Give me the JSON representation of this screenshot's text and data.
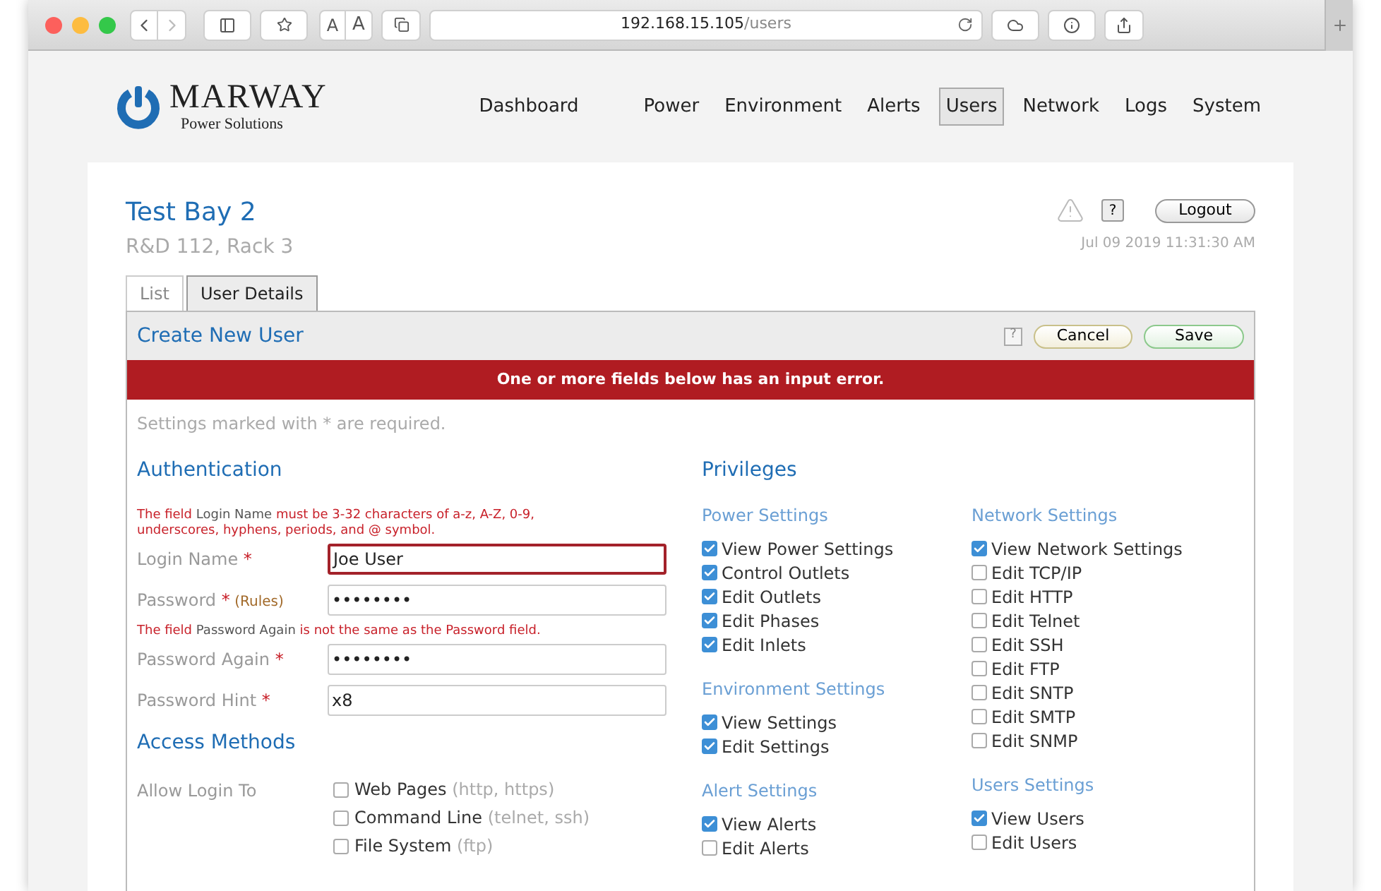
{
  "browser": {
    "font_buttons": [
      "A",
      "A"
    ],
    "url_host": "192.168.15.105",
    "url_path": "/users"
  },
  "nav": {
    "logo": {
      "name": "MARWAY",
      "tagline": "Power Solutions"
    },
    "items": [
      {
        "label": "Dashboard",
        "selected": false
      },
      {
        "label": "Power",
        "selected": false
      },
      {
        "label": "Environment",
        "selected": false
      },
      {
        "label": "Alerts",
        "selected": false
      },
      {
        "label": "Users",
        "selected": true
      },
      {
        "label": "Network",
        "selected": false
      },
      {
        "label": "Logs",
        "selected": false
      },
      {
        "label": "System",
        "selected": false
      }
    ]
  },
  "header": {
    "title": "Test Bay 2",
    "subtitle": "R&D 112, Rack 3",
    "help": "?",
    "logout": "Logout",
    "datetime": "Jul 09 2019 11:31:30 AM"
  },
  "tabs": [
    {
      "label": "List",
      "selected": false
    },
    {
      "label": "User Details",
      "selected": true
    }
  ],
  "panel": {
    "title": "Create New User",
    "help": "?",
    "cancel": "Cancel",
    "save": "Save",
    "error_banner": "One or more fields below has an input error.",
    "required_note": "Settings marked with * are required."
  },
  "authentication": {
    "heading": "Authentication",
    "rows": [
      {
        "kind": "error",
        "before": "The field",
        "field": "Login Name",
        "after": "must be 3-32 characters of a-z, A-Z, 0-9, underscores, hyphens, periods, and @ symbol."
      },
      {
        "kind": "field",
        "label": "Login Name",
        "required": "*",
        "value": "Joe User",
        "invalid": true
      },
      {
        "kind": "field",
        "label": "Password",
        "required": "*",
        "note": "(Rules)",
        "value": "••••••••",
        "invalid": false
      },
      {
        "kind": "error",
        "before": "The field",
        "field": "Password Again",
        "after": "is not the same as the Password field."
      },
      {
        "kind": "field",
        "label": "Password Again",
        "required": "*",
        "value": "••••••••",
        "invalid": false
      },
      {
        "kind": "field",
        "label": "Password Hint",
        "required": "*",
        "value": "x8",
        "invalid": false
      }
    ]
  },
  "access": {
    "heading": "Access Methods",
    "label": "Allow Login To",
    "options": [
      {
        "label": "Web Pages",
        "hint": "(http, https)",
        "checked": false
      },
      {
        "label": "Command Line",
        "hint": "(telnet, ssh)",
        "checked": false
      },
      {
        "label": "File System",
        "hint": "(ftp)",
        "checked": false
      }
    ]
  },
  "privileges": {
    "heading": "Privileges",
    "columns": [
      [
        {
          "title": "Power Settings",
          "items": [
            {
              "label": "View Power Settings",
              "checked": true
            },
            {
              "label": "Control Outlets",
              "checked": true
            },
            {
              "label": "Edit Outlets",
              "checked": true
            },
            {
              "label": "Edit Phases",
              "checked": true
            },
            {
              "label": "Edit Inlets",
              "checked": true
            }
          ]
        },
        {
          "title": "Environment Settings",
          "items": [
            {
              "label": "View Settings",
              "checked": true
            },
            {
              "label": "Edit Settings",
              "checked": true
            }
          ]
        },
        {
          "title": "Alert Settings",
          "items": [
            {
              "label": "View Alerts",
              "checked": true
            },
            {
              "label": "Edit Alerts",
              "checked": false
            }
          ]
        }
      ],
      [
        {
          "title": "Network Settings",
          "items": [
            {
              "label": "View Network Settings",
              "checked": true
            },
            {
              "label": "Edit TCP/IP",
              "checked": false
            },
            {
              "label": "Edit HTTP",
              "checked": false
            },
            {
              "label": "Edit Telnet",
              "checked": false
            },
            {
              "label": "Edit SSH",
              "checked": false
            },
            {
              "label": "Edit FTP",
              "checked": false
            },
            {
              "label": "Edit SNTP",
              "checked": false
            },
            {
              "label": "Edit SMTP",
              "checked": false
            },
            {
              "label": "Edit SNMP",
              "checked": false
            }
          ]
        },
        {
          "title": "Users Settings",
          "items": [
            {
              "label": "View Users",
              "checked": true
            },
            {
              "label": "Edit Users",
              "checked": false
            }
          ]
        }
      ]
    ]
  }
}
